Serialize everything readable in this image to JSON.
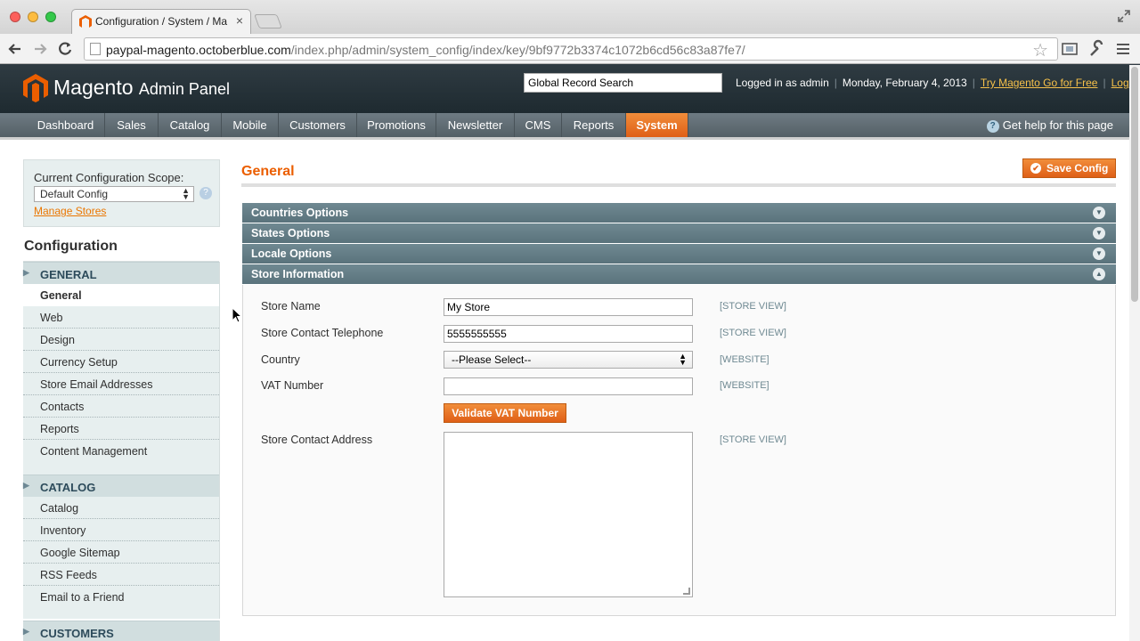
{
  "browser": {
    "tab_title": "Configuration / System / Ma",
    "tab_close": "×",
    "url_host": "paypal-magento.octoberblue.com",
    "url_path": "/index.php/admin/system_config/index/key/9bf9772b3374c1072b6cd56c83a87fe7/"
  },
  "header": {
    "logo_main": "Magento",
    "logo_sub": "Admin Panel",
    "search_value": "Global Record Search",
    "logged_in": "Logged in as admin",
    "date": "Monday, February 4, 2013",
    "try_link": "Try Magento Go for Free",
    "logout": "Log Out"
  },
  "nav": {
    "items": [
      "Dashboard",
      "Sales",
      "Catalog",
      "Mobile",
      "Customers",
      "Promotions",
      "Newsletter",
      "CMS",
      "Reports",
      "System"
    ],
    "active": "System",
    "help": "Get help for this page"
  },
  "sidebar": {
    "scope_label": "Current Configuration Scope:",
    "scope_value": "Default Config",
    "manage_stores": "Manage Stores",
    "config_title": "Configuration",
    "general_head": "GENERAL",
    "general_items": [
      "General",
      "Web",
      "Design",
      "Currency Setup",
      "Store Email Addresses",
      "Contacts",
      "Reports",
      "Content Management"
    ],
    "catalog_head": "CATALOG",
    "catalog_items": [
      "Catalog",
      "Inventory",
      "Google Sitemap",
      "RSS Feeds",
      "Email to a Friend"
    ],
    "customers_head": "CUSTOMERS"
  },
  "main": {
    "title": "General",
    "save_button": "Save Config",
    "sections": [
      "Countries Options",
      "States Options",
      "Locale Options",
      "Store Information"
    ],
    "fields": {
      "store_name_label": "Store Name",
      "store_name_value": "My Store",
      "store_name_scope": "[STORE VIEW]",
      "telephone_label": "Store Contact Telephone",
      "telephone_value": "5555555555",
      "telephone_scope": "[STORE VIEW]",
      "country_label": "Country",
      "country_value": "--Please Select--",
      "country_scope": "[WEBSITE]",
      "vat_label": "VAT Number",
      "vat_value": "",
      "vat_scope": "[WEBSITE]",
      "vat_button": "Validate VAT Number",
      "address_label": "Store Contact Address",
      "address_scope": "[STORE VIEW]"
    }
  },
  "colors": {
    "accent_orange": "#df5f17",
    "header_dark": "#2f3b42",
    "section_bar": "#6f8992"
  },
  "icons": [
    "magento-logo-icon",
    "star-icon",
    "help-icon",
    "save-check-icon",
    "collapse-toggle-icon"
  ]
}
